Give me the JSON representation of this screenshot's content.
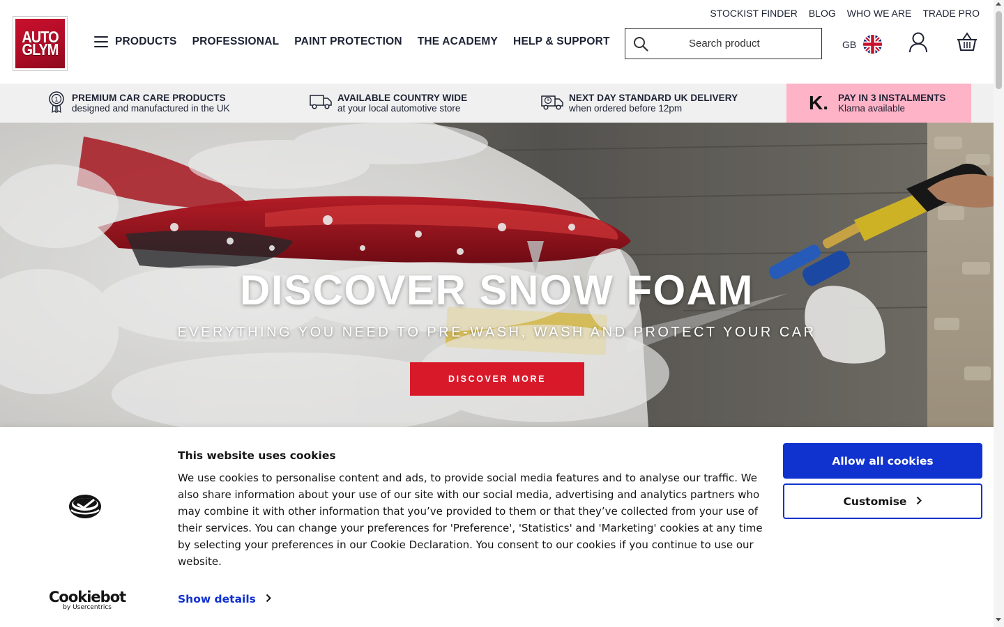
{
  "header": {
    "logo_text": [
      "AUTO",
      "GLYM"
    ],
    "utility_links": [
      "STOCKIST FINDER",
      "BLOG",
      "WHO WE ARE",
      "TRADE PRO"
    ],
    "nav": [
      "PRODUCTS",
      "PROFESSIONAL",
      "PAINT PROTECTION",
      "THE ACADEMY",
      "HELP & SUPPORT"
    ],
    "search_placeholder": "Search product",
    "country_code": "GB",
    "icons": [
      "menu-icon",
      "search-icon",
      "uk-flag-icon",
      "account-icon",
      "basket-icon"
    ]
  },
  "usp": [
    {
      "title": "PREMIUM CAR CARE PRODUCTS",
      "subtitle": "designed and manufactured in the UK",
      "icon": "award-badge-icon"
    },
    {
      "title": "AVAILABLE COUNTRY WIDE",
      "subtitle": "at your local automotive store",
      "icon": "truck-icon"
    },
    {
      "title": "NEXT DAY STANDARD UK DELIVERY",
      "subtitle": "when ordered before 12pm",
      "icon": "delivery-truck-clock-icon"
    },
    {
      "title": "PAY IN 3 INSTALMENTS",
      "subtitle": "Klarna available",
      "icon": "klarna-logo-icon",
      "logo": "K."
    }
  ],
  "hero": {
    "title": "DISCOVER SNOW FOAM",
    "subtitle": "EVERYTHING YOU NEED TO PRE-WASH, WASH AND PROTECT YOUR CAR",
    "cta": "DISCOVER MORE"
  },
  "cookie_banner": {
    "title": "This website uses cookies",
    "body": "We use cookies to personalise content and ads, to provide social media features and to analyse our traffic. We also share information about your use of our site with our social media, advertising and analytics partners who may combine it with other information that you’ve provided to them or that they’ve collected from your use of their services. You can change your preferences for 'Preference', 'Statistics' and 'Marketing' cookies at any time by selecting your preferences in our Cookie Declaration. You consent to our cookies if you continue to use our website.",
    "show_details": "Show details",
    "allow_all": "Allow all cookies",
    "customise": "Customise",
    "provider_name": "Cookiebot",
    "provider_sub": "by Usercentrics"
  },
  "colors": {
    "brand_red": "#c8102e",
    "cta_red": "#d8192a",
    "nav_text": "#1d2233",
    "usp_bg": "#f0f0f1",
    "klarna_pink": "#ffb3c7",
    "cookie_blue": "#1032cf"
  }
}
